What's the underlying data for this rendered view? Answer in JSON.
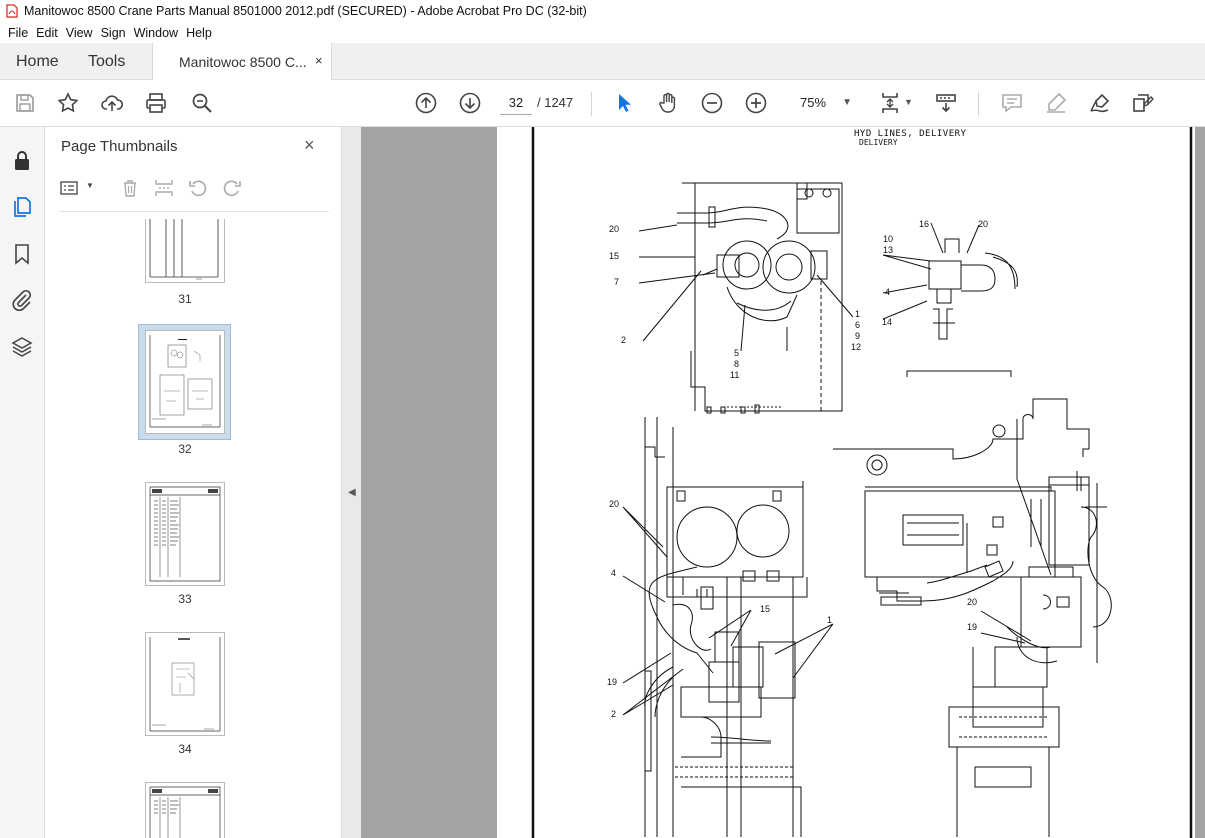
{
  "window": {
    "title": "Manitowoc 8500 Crane Parts Manual 8501000 2012.pdf (SECURED) - Adobe Acrobat Pro DC (32-bit)"
  },
  "menu": [
    "File",
    "Edit",
    "View",
    "Sign",
    "Window",
    "Help"
  ],
  "tabs": {
    "home": "Home",
    "tools": "Tools",
    "document": "Manitowoc 8500 C...",
    "close": "×"
  },
  "toolbar": {
    "page_current": "32",
    "page_total": "/  1247",
    "zoom": "75%"
  },
  "thumbnails_panel": {
    "title": "Page Thumbnails",
    "close": "×",
    "pages": [
      {
        "label": "31",
        "selected": false
      },
      {
        "label": "32",
        "selected": true
      },
      {
        "label": "33",
        "selected": false
      },
      {
        "label": "34",
        "selected": false
      }
    ]
  },
  "document_page": {
    "header": "HYD LINES, DELIVERY",
    "subheader": "DELIVERY",
    "callouts": {
      "c20a": "20",
      "c15a": "15",
      "c7": "7",
      "c2a": "2",
      "c5": "5",
      "c8": "8",
      "c11": "11",
      "c1a": "1",
      "c6": "6",
      "c9": "9",
      "c12": "12",
      "c16": "16",
      "c20b": "20",
      "c10": "10",
      "c13": "13",
      "c4a": "4",
      "c14": "14",
      "c20c": "20",
      "c4b": "4",
      "c15b": "15",
      "c1b": "1",
      "c19a": "19",
      "c2b": "2",
      "c20d": "20",
      "c19b": "19"
    }
  },
  "colors": {
    "accent": "#1473e6",
    "panel_bg": "#f5f5f5",
    "doc_bg": "#a4a4a4",
    "selection": "#c9dcec"
  }
}
